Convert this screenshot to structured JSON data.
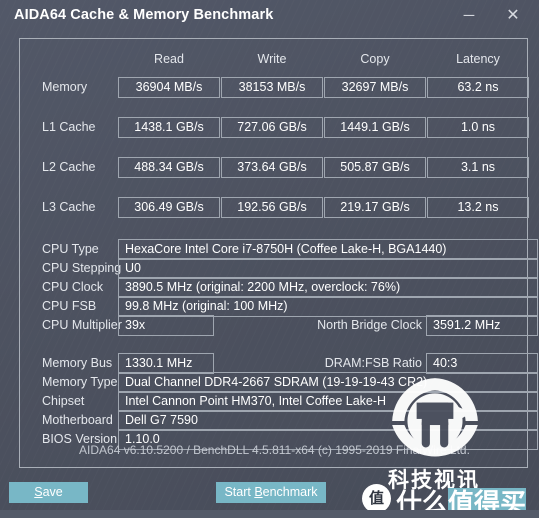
{
  "window": {
    "title": "AIDA64 Cache & Memory Benchmark",
    "minimize_label": "─",
    "close_label": "✕",
    "accent_color": "#78b7c6",
    "background_color": "#4d5260",
    "border_color": "#a9afb8"
  },
  "benchmark": {
    "columns": [
      "Read",
      "Write",
      "Copy",
      "Latency"
    ],
    "rows": [
      {
        "label": "Memory",
        "values": [
          "36904 MB/s",
          "38153 MB/s",
          "32697 MB/s",
          "63.2 ns"
        ]
      },
      {
        "label": "L1 Cache",
        "values": [
          "1438.1 GB/s",
          "727.06 GB/s",
          "1449.1 GB/s",
          "1.0 ns"
        ]
      },
      {
        "label": "L2 Cache",
        "values": [
          "488.34 GB/s",
          "373.64 GB/s",
          "505.87 GB/s",
          "3.1 ns"
        ]
      },
      {
        "label": "L3 Cache",
        "values": [
          "306.49 GB/s",
          "192.56 GB/s",
          "219.17 GB/s",
          "13.2 ns"
        ]
      }
    ]
  },
  "cpu_info": [
    {
      "label": "CPU Type",
      "value": "HexaCore Intel Core i7-8750H  (Coffee Lake-H, BGA1440)"
    },
    {
      "label": "CPU Stepping",
      "value": "U0"
    },
    {
      "label": "CPU Clock",
      "value": "3890.5 MHz  (original: 2200 MHz, overclock: 76%)"
    },
    {
      "label": "CPU FSB",
      "value": "99.8 MHz  (original: 100 MHz)"
    }
  ],
  "cpu_multiplier": {
    "label": "CPU Multiplier",
    "value": "39x",
    "side_label": "North Bridge Clock",
    "side_value": "3591.2 MHz"
  },
  "memory_bus": {
    "label": "Memory Bus",
    "value": "1330.1 MHz",
    "side_label": "DRAM:FSB Ratio",
    "side_value": "40:3"
  },
  "system_info": [
    {
      "label": "Memory Type",
      "value": "Dual Channel DDR4-2667 SDRAM  (19-19-19-43 CR2)"
    },
    {
      "label": "Chipset",
      "value": "Intel Cannon Point HM370, Intel Coffee Lake-H"
    },
    {
      "label": "Motherboard",
      "value": "Dell G7 7590"
    },
    {
      "label": "BIOS Version",
      "value": "1.10.0"
    }
  ],
  "version_line": "AIDA64 v6.10.5200 / BenchDLL 4.5.811-x64  (c) 1995-2019 FinalWire Ltd.",
  "buttons": {
    "save": {
      "prefix": "",
      "accel": "S",
      "suffix": "ave"
    },
    "start": {
      "prefix": "Start ",
      "accel": "B",
      "suffix": "enchmark"
    }
  },
  "watermarks": {
    "tech_news": "科技视讯",
    "zhi_badge": "值",
    "smzdm_plain": "什么",
    "smzdm_highlight": "值得买"
  }
}
